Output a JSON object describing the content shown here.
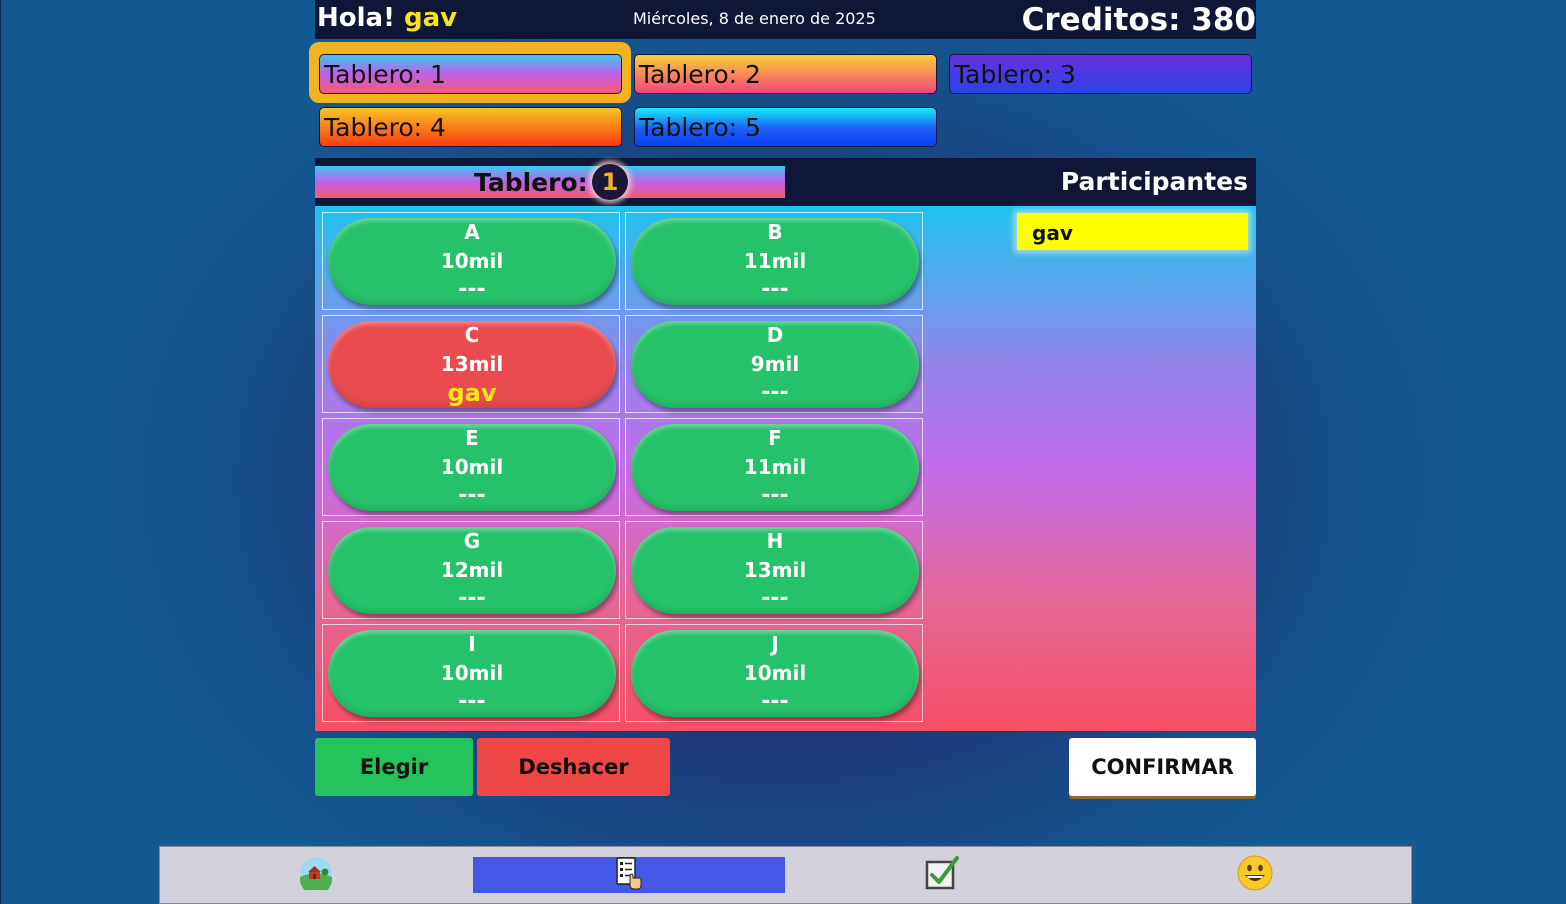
{
  "header": {
    "greeting": "Hola!",
    "username": "gav",
    "date": "Miércoles, 8 de enero de 2025",
    "credits": "Creditos: 380"
  },
  "tableros": [
    {
      "label": "Tablero: 1",
      "selected": true
    },
    {
      "label": "Tablero: 2",
      "selected": false
    },
    {
      "label": "Tablero: 3",
      "selected": false
    },
    {
      "label": "Tablero: 4",
      "selected": false
    },
    {
      "label": "Tablero: 5",
      "selected": false
    }
  ],
  "board": {
    "label": "Tablero:",
    "number": "1",
    "participants_title": "Participantes",
    "participants": [
      "gav"
    ],
    "seats": [
      {
        "letter": "A",
        "price": "10mil",
        "occupant": "---",
        "status": "free"
      },
      {
        "letter": "B",
        "price": "11mil",
        "occupant": "---",
        "status": "free"
      },
      {
        "letter": "C",
        "price": "13mil",
        "occupant": "gav",
        "status": "taken"
      },
      {
        "letter": "D",
        "price": "9mil",
        "occupant": "---",
        "status": "free"
      },
      {
        "letter": "E",
        "price": "10mil",
        "occupant": "---",
        "status": "free"
      },
      {
        "letter": "F",
        "price": "11mil",
        "occupant": "---",
        "status": "free"
      },
      {
        "letter": "G",
        "price": "12mil",
        "occupant": "---",
        "status": "free"
      },
      {
        "letter": "H",
        "price": "13mil",
        "occupant": "---",
        "status": "free"
      },
      {
        "letter": "I",
        "price": "10mil",
        "occupant": "---",
        "status": "free"
      },
      {
        "letter": "J",
        "price": "10mil",
        "occupant": "---",
        "status": "free"
      }
    ]
  },
  "actions": {
    "elegir": "Elegir",
    "deshacer": "Deshacer",
    "confirmar": "CONFIRMAR"
  },
  "nav": [
    {
      "icon": "home-landscape-icon",
      "active": false
    },
    {
      "icon": "checklist-pointer-icon",
      "active": true
    },
    {
      "icon": "checkbox-checked-icon",
      "active": false
    },
    {
      "icon": "smiley-face-icon",
      "active": false
    }
  ],
  "colors": {
    "free_seat": "#26c26a",
    "taken_seat": "#ea4b50",
    "selected_tab_outline": "#f2b321",
    "participant_highlight": "#ffff00",
    "nav_active": "#4457e6"
  }
}
